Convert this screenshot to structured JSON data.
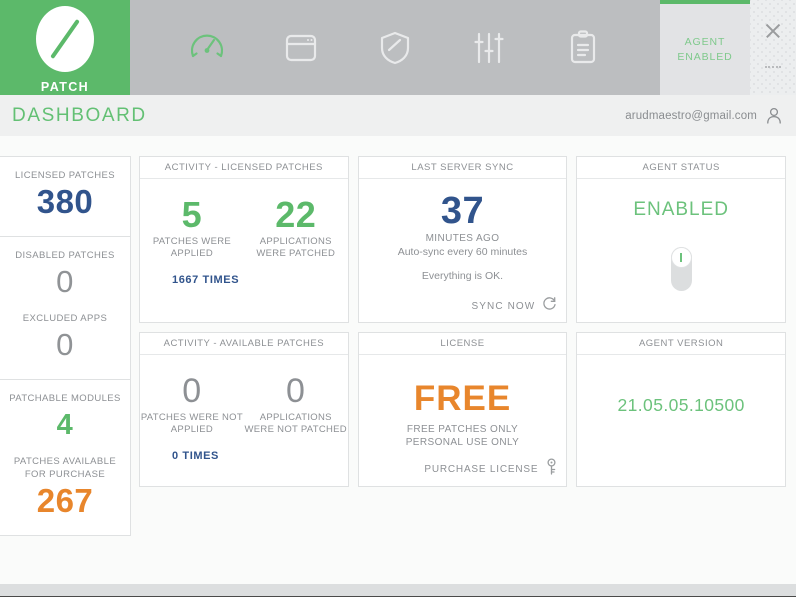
{
  "app": {
    "brand": "PATCH",
    "window_close": "close-icon",
    "window_minimize": "minimize-icon"
  },
  "nav": {
    "items": [
      {
        "icon": "gauge-icon",
        "name": "dashboard",
        "active": true
      },
      {
        "icon": "browser-icon",
        "name": "patches",
        "active": false
      },
      {
        "icon": "shield-icon",
        "name": "security",
        "active": false
      },
      {
        "icon": "sliders-icon",
        "name": "settings",
        "active": false
      },
      {
        "icon": "clipboard-icon",
        "name": "reports",
        "active": false
      }
    ]
  },
  "agent_panel": {
    "line1": "AGENT",
    "line2": "ENABLED"
  },
  "dash_bar": {
    "title": "DASHBOARD",
    "user_email": "arudmaestro@gmail.com",
    "user_icon": "user-icon"
  },
  "stats": [
    {
      "label": "LICENSED PATCHES",
      "value": "380",
      "tone": "navy"
    },
    {
      "label": "DISABLED PATCHES",
      "value": "0",
      "tone": "gray"
    },
    {
      "label": "EXCLUDED APPS",
      "value": "0",
      "tone": "gray"
    },
    {
      "label": "PATCHABLE MODULES",
      "value": "4",
      "tone": "green"
    },
    {
      "label": "PATCHES AVAILABLE FOR PURCHASE",
      "value": "267",
      "tone": "orange"
    }
  ],
  "cards": {
    "activity_licensed": {
      "title": "ACTIVITY - LICENSED PATCHES",
      "left_value": "5",
      "left_caption": "PATCHES WERE APPLIED",
      "right_value": "22",
      "right_caption": "APPLICATIONS WERE PATCHED",
      "times": "1667 TIMES"
    },
    "last_server_sync": {
      "title": "LAST SERVER SYNC",
      "value": "37",
      "caption": "MINUTES AGO",
      "auto_sync": "Auto-sync every 60 minutes",
      "status": "Everything is OK.",
      "action_label": "SYNC NOW",
      "action_icon": "refresh-icon"
    },
    "agent_status": {
      "title": "AGENT STATUS",
      "state": "ENABLED",
      "toggle": "on"
    },
    "activity_available": {
      "title": "ACTIVITY - AVAILABLE PATCHES",
      "left_value": "0",
      "left_caption": "PATCHES WERE NOT APPLIED",
      "right_value": "0",
      "right_caption": "APPLICATIONS WERE NOT PATCHED",
      "times": "0 TIMES"
    },
    "license": {
      "title": "LICENSE",
      "tier": "FREE",
      "line1": "FREE PATCHES ONLY",
      "line2": "PERSONAL USE ONLY",
      "action_label": "PURCHASE LICENSE",
      "action_icon": "key-icon"
    },
    "agent_version": {
      "title": "AGENT VERSION",
      "version": "21.05.05.10500"
    }
  },
  "colors": {
    "brand_green": "#5cb96a",
    "accent_green": "#6cc27c",
    "navy": "#31548c",
    "orange": "#e8862c",
    "gray_text": "#8d9094",
    "header_gray": "#bcbec0"
  }
}
